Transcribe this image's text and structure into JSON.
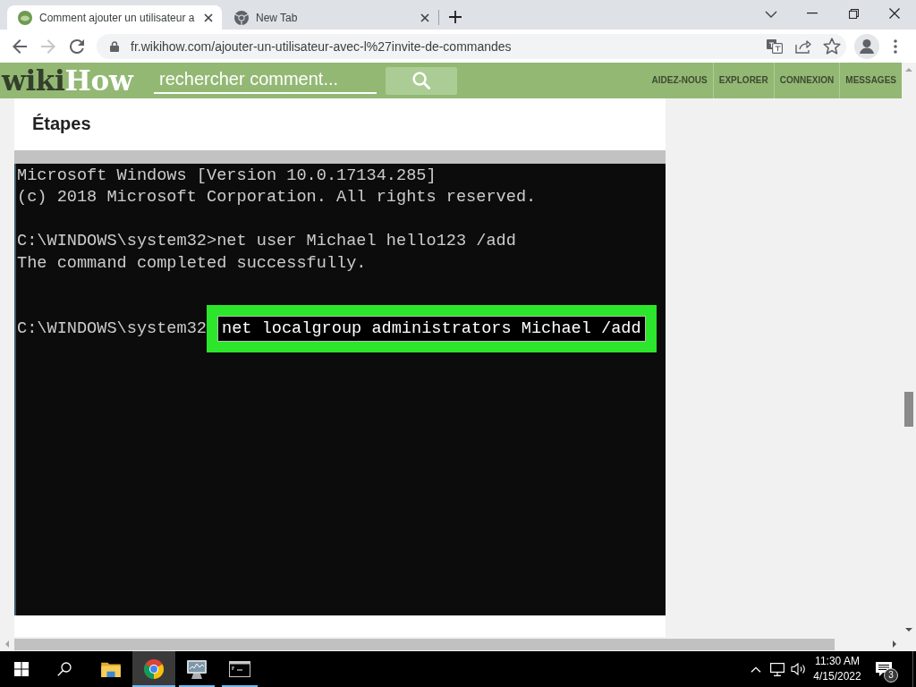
{
  "browser": {
    "tabs": [
      {
        "kind": "site",
        "title": "Comment ajouter un utilisateur a",
        "selected": true
      },
      {
        "kind": "browser",
        "title": "New Tab",
        "selected": false
      }
    ],
    "toolbar": {
      "nav_buttons": [
        {
          "kind": "back",
          "disabled": false
        },
        {
          "kind": "forward",
          "disabled": true
        },
        {
          "kind": "reload",
          "disabled": false
        }
      ],
      "url": "fr.wikihow.com/ajouter-un-utilisateur-avec-l%27invite-de-commandes"
    }
  },
  "site_header": {
    "logo": {
      "first": "wiki",
      "second": "How"
    },
    "search": {
      "placeholder": "rechercher comment..."
    },
    "nav": [
      "AIDEZ-NOUS",
      "EXPLORER",
      "CONNEXION",
      "MESSAGES"
    ]
  },
  "article": {
    "heading": "Étapes",
    "console": {
      "lines": [
        {
          "kind": "text",
          "text": "Microsoft Windows [Version 10.0.17134.285]"
        },
        {
          "kind": "text",
          "text": "(c) 2018 Microsoft Corporation. All rights reserved."
        },
        {
          "kind": "blank"
        },
        {
          "kind": "text",
          "text": "C:\\WINDOWS\\system32>net user Michael hello123 /add"
        },
        {
          "kind": "text",
          "text": "The command completed successfully."
        },
        {
          "kind": "blank"
        },
        {
          "kind": "blank"
        },
        {
          "kind": "command",
          "prompt": "C:\\WINDOWS\\system32",
          "command": "net localgroup administrators Michael /add",
          "highlighted": true
        }
      ]
    }
  },
  "taskbar": {
    "apps": [
      {
        "kind": "file_explorer",
        "running": false,
        "selected": false
      },
      {
        "kind": "chrome",
        "running": true,
        "selected": true
      },
      {
        "kind": "server_manager",
        "running": true,
        "selected": false
      },
      {
        "kind": "command_prompt",
        "running": true,
        "selected": false
      }
    ],
    "clock": {
      "time": "11:30 AM",
      "date": "4/15/2022"
    },
    "notifications": {
      "count": "3"
    }
  }
}
